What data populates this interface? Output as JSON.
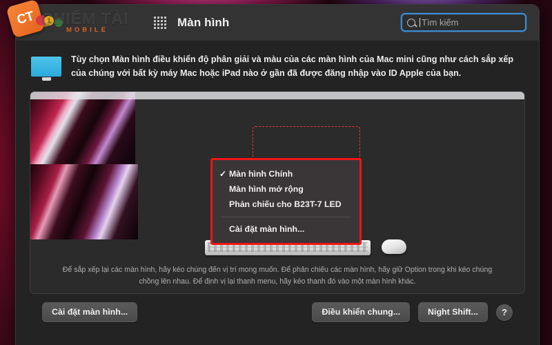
{
  "watermark": {
    "badge_text": "CT",
    "main_text": "CHIẾM TÀI",
    "sub_text": "MOBILE",
    "dot_number": "1"
  },
  "titlebar": {
    "title": "Màn hình",
    "grid_icon": "grid-apps-icon",
    "traffic_lights": [
      "close",
      "minimize",
      "zoom"
    ]
  },
  "search": {
    "placeholder": "Tìm kiếm",
    "icon": "search-icon",
    "focused": true,
    "accent_color": "#3c8ed6"
  },
  "description": {
    "icon": "display-monitor-icon",
    "text": "Tùy chọn Màn hình điều khiển độ phân giải và màu của các màn hình của Mac mini cũng như cách sắp xếp của chúng với bất kỳ máy Mac hoặc iPad nào ở gần đã được đăng nhập vào ID Apple của bạn."
  },
  "arrangement": {
    "displays": [
      {
        "name": "main-display",
        "role": "Màn hình Chính",
        "has_menubar": true,
        "selected": false
      },
      {
        "name": "extended-display",
        "role": "Màn hình mở rộng",
        "has_menubar": false,
        "selected": true
      }
    ],
    "peripherals": [
      "magic-keyboard",
      "magic-mouse"
    ],
    "hint_text": "Để sắp xếp lại các màn hình, hãy kéo chúng đến vị trí mong muốn. Để phản chiếu các màn hình, hãy giữ Option trong khi kéo chúng chồng lên nhau. Để định vị lại thanh menu, hãy kéo thanh đó vào một màn hình khác."
  },
  "context_menu": {
    "annotation_color": "#f01515",
    "items": [
      {
        "label": "Màn hình Chính",
        "checked": true,
        "check_glyph": "✓"
      },
      {
        "label": "Màn hình mở rộng",
        "checked": false,
        "check_glyph": ""
      },
      {
        "label": "Phản chiếu cho B23T-7 LED",
        "checked": false,
        "check_glyph": ""
      }
    ],
    "footer_item": {
      "label": "Cài đặt màn hình...",
      "checked": false,
      "check_glyph": ""
    }
  },
  "footer": {
    "display_settings_label": "Cài đặt màn hình...",
    "universal_control_label": "Điều khiển chung...",
    "night_shift_label": "Night Shift...",
    "help_label": "?"
  }
}
